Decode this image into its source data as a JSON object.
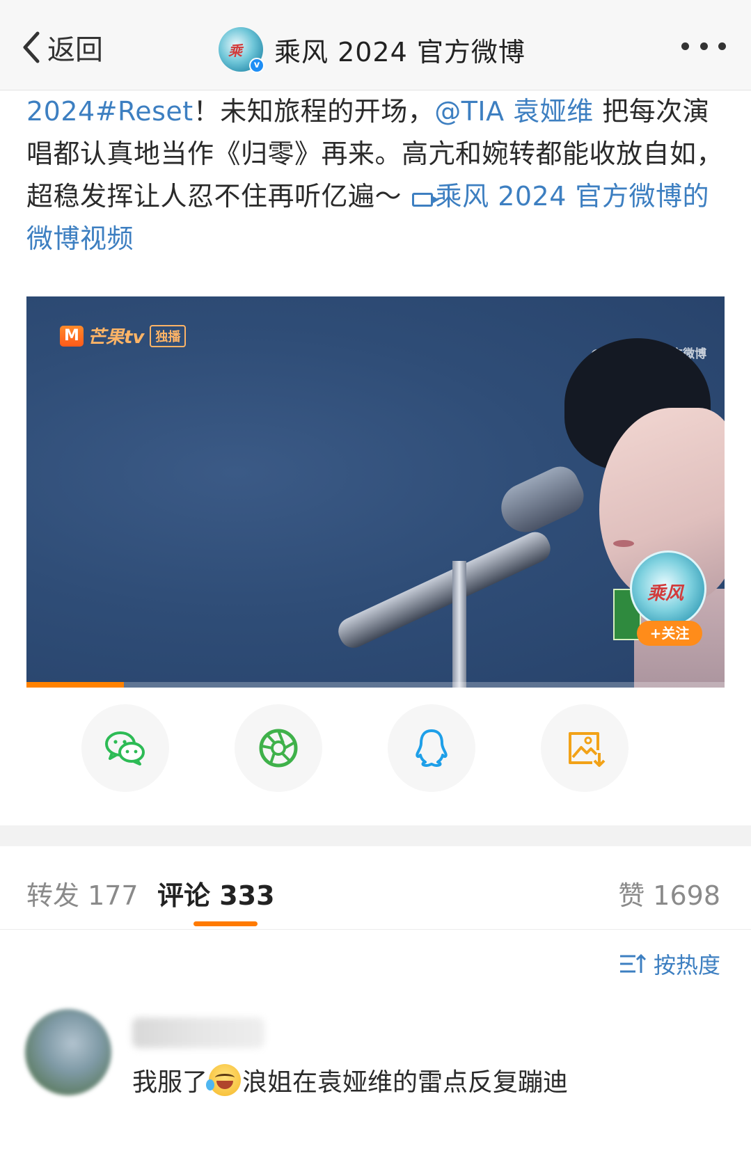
{
  "header": {
    "back_label": "返回",
    "title": "乘风 2024 官方微博",
    "avatar_mark": "乘风2024"
  },
  "post": {
    "hashtag": "2024#Reset",
    "text_1": "！未知旅程的开场，",
    "mention": "@TIA 袁娅维",
    "text_2": " 把每次演唱都认真地当作《归零》再来。高亢和婉转都能收放自如，超稳发挥让人忍不住再听亿遍～",
    "video_link": "乘风 2024 官方微博的微博视频"
  },
  "video": {
    "logo_m": "M",
    "logo_text": "芒果tv",
    "logo_badge": "独播",
    "watermark": "@乘风2024官方微博",
    "follow_label": "+关注",
    "badge_mark": "乘风2024",
    "progress": 0.14
  },
  "share": [
    {
      "icon": "wechat-icon",
      "color": "#2dbb55"
    },
    {
      "icon": "moments-icon",
      "color": "#3fb14a"
    },
    {
      "icon": "qq-icon",
      "color": "#1e9fe8"
    },
    {
      "icon": "save-image-icon",
      "color": "#f2a218"
    }
  ],
  "tabs": {
    "repost": "转发 177",
    "comments": "评论 333",
    "likes": "赞 1698"
  },
  "sort_label": "按热度",
  "comments": [
    {
      "text_before": "我服了",
      "emoji": "laugh-cry-emoji",
      "text_after": "浪姐在袁娅维的雷点反复蹦迪"
    }
  ],
  "colors": {
    "link": "#3d7fc1",
    "accent": "#ff7a00",
    "verified": "#1e8ef5"
  }
}
